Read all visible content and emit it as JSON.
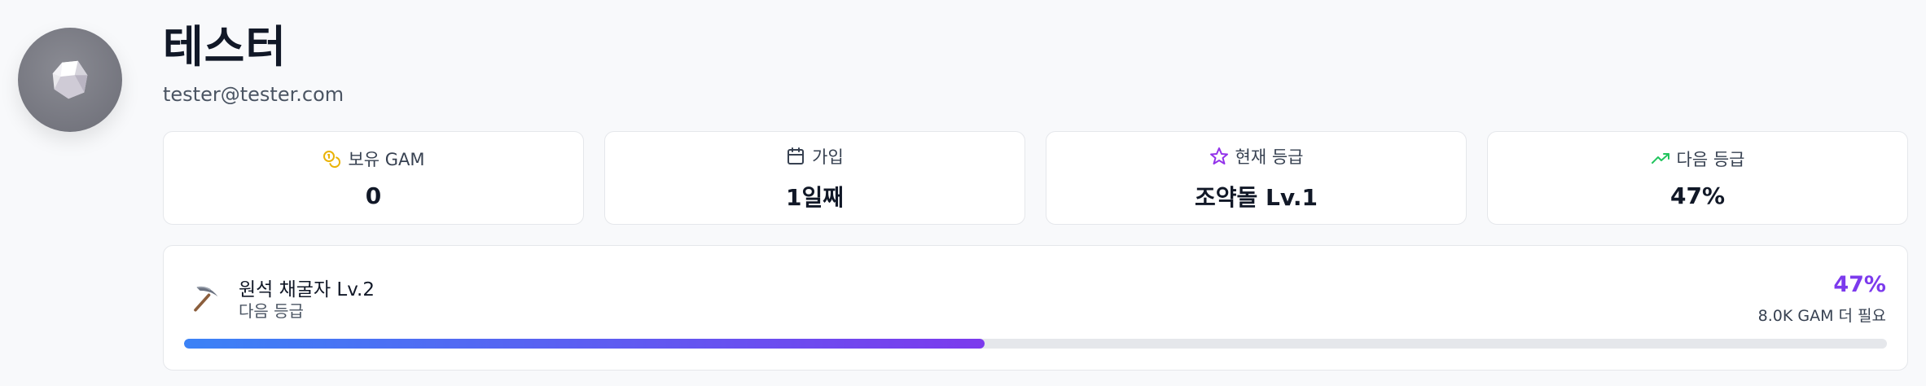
{
  "profile": {
    "name": "테스터",
    "email": "tester@tester.com"
  },
  "stats": [
    {
      "icon": "coins-icon",
      "label": "보유 GAM",
      "value": "0",
      "color": "#eab308"
    },
    {
      "icon": "calendar-icon",
      "label": "가입",
      "value": "1일째",
      "color": "#374151"
    },
    {
      "icon": "star-icon",
      "label": "현재 등급",
      "value": "조약돌 Lv.1",
      "color": "#9333ea"
    },
    {
      "icon": "trending-up-icon",
      "label": "다음 등급",
      "value": "47%",
      "color": "#22c55e"
    }
  ],
  "progress": {
    "icon": "pickaxe-icon",
    "tier_name": "원석 채굴자 Lv.2",
    "tier_sub": "다음 등급",
    "percent_text": "47%",
    "percent": 47,
    "needed": "8.0K GAM 더 필요",
    "accent": "#7c3aed"
  }
}
